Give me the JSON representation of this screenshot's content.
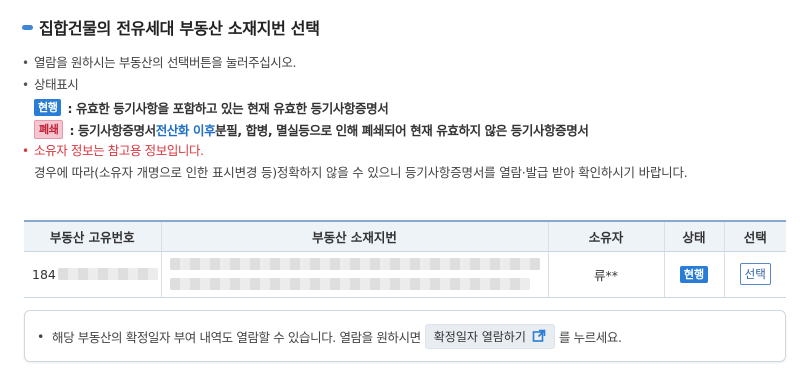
{
  "header": {
    "title": "집합건물의 전유세대 부동산 소재지번 선택"
  },
  "notes": {
    "item1": "열람을 원하시는 부동산의 선택버튼을 눌러주십시오.",
    "item2": "상태표시",
    "status_current": {
      "badge": "현행",
      "text": ": 유효한 등기사항을 포함하고 있는 현재 유효한 등기사항증명서"
    },
    "status_closed": {
      "badge": "폐쇄",
      "text_prefix": ": 등기사항증명서 ",
      "text_highlight": "전산화 이후",
      "text_suffix": " 분필, 합병, 멸실등으로 인해 폐쇄되어 현재 유효하지 않은 등기사항증명서"
    },
    "warning": "소유자 정보는 참고용 정보입니다.",
    "warning_detail": "경우에 따라(소유자 개명으로 인한 표시변경 등)정확하지 않을 수 있으니 등기사항증명서를 열람·발급 받아 확인하시기 바랍니다."
  },
  "table": {
    "headers": [
      "부동산 고유번호",
      "부동산 소재지번",
      "소유자",
      "상태",
      "선택"
    ],
    "rows": [
      {
        "id_prefix": "184",
        "owner": "류**",
        "status": "현행",
        "select_label": "선택"
      }
    ]
  },
  "info": {
    "text_before": "해당 부동산의 확정일자 부여 내역도 열람할 수 있습니다. 열람을 원하시면",
    "button_label": "확정일자 열람하기",
    "text_after": "를 누르세요."
  },
  "colors": {
    "accent": "#2a7dd4",
    "warning": "#d9363e",
    "badge_closed": "#f5c6cf"
  }
}
